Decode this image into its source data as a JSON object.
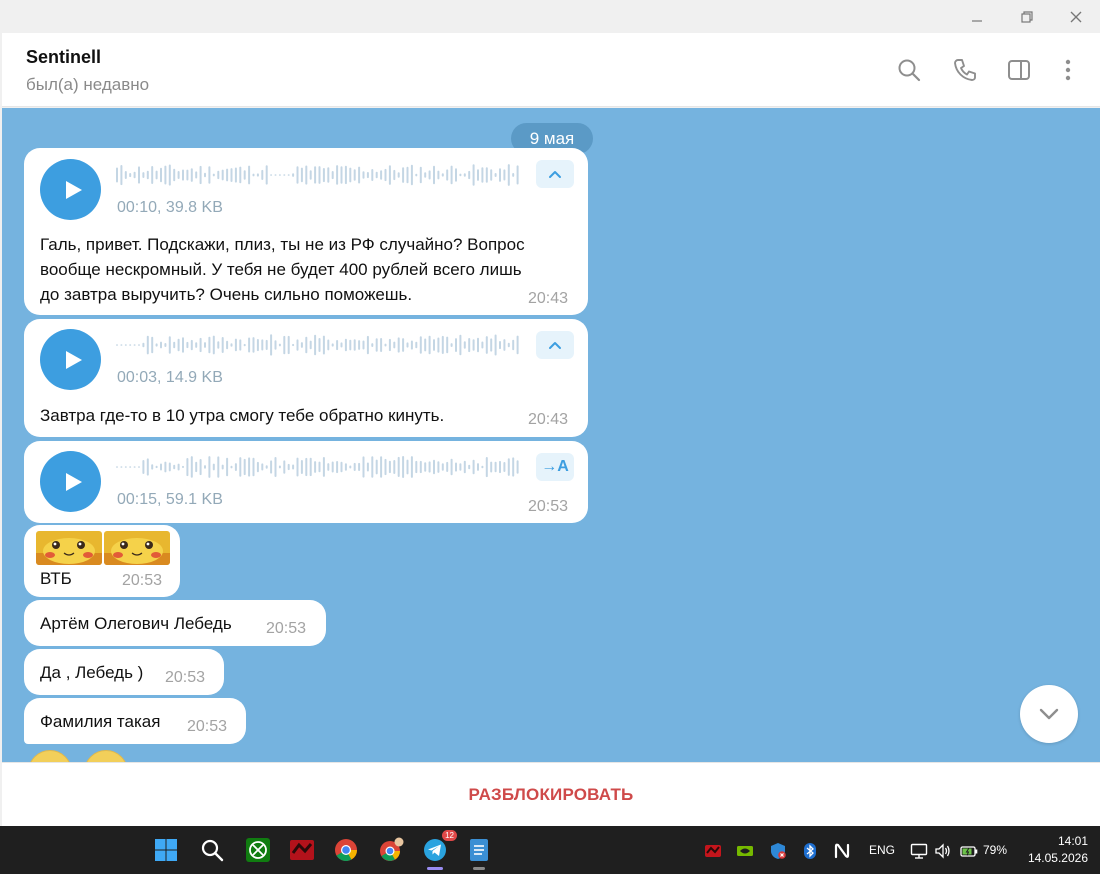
{
  "chat": {
    "name": "Sentinell",
    "status": "был(а) недавно",
    "date_pill": "9 мая"
  },
  "messages": [
    {
      "type": "voice",
      "meta": "00:10, 39.8 KB",
      "text_lines": [
        "Галь, привет. Подскажи, плиз, ты не из РФ случайно? Вопрос",
        "вообще нескромный. У тебя не будет 400 рублей всего лишь",
        "до завтра выручить? Очень сильно поможешь."
      ],
      "time": "20:43",
      "action_icon": "chevron-up-icon"
    },
    {
      "type": "voice",
      "meta": "00:03, 14.9 KB",
      "text_lines": [
        "Завтра где-то в 10 утра смогу тебе обратно кинуть."
      ],
      "time": "20:43",
      "action_icon": "chevron-up-icon"
    },
    {
      "type": "voice",
      "meta": "00:15, 59.1 KB",
      "text_lines": [],
      "time": "20:53",
      "action_label": "→A"
    },
    {
      "type": "text",
      "text": "ВТБ",
      "time": "20:53",
      "stickers": 2
    },
    {
      "type": "text",
      "text": "Артём Олегович Лебедь",
      "time": "20:53"
    },
    {
      "type": "text",
      "text": "Да , Лебедь )",
      "time": "20:53"
    },
    {
      "type": "text",
      "text": "Фамилия такая",
      "time": "20:53"
    }
  ],
  "bottom": {
    "unblock_label": "РАЗБЛОКИРОВАТЬ"
  },
  "taskbar": {
    "telegram_badge": "12",
    "lang": "ENG",
    "battery": "79%",
    "time": "14:01",
    "date": "14.05.2026"
  },
  "colors": {
    "chat_bg": "#75b3df",
    "accent": "#3d9ee0",
    "unblock": "#cf4a4a",
    "date_pill": "#5b9ac6"
  }
}
